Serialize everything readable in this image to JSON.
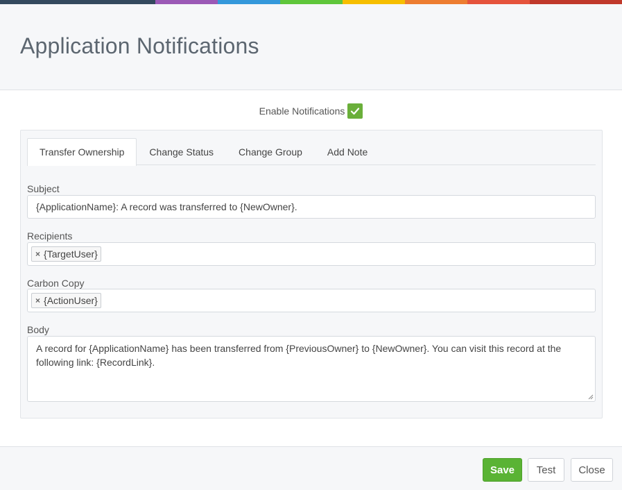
{
  "colors": {
    "top_bar": [
      "#34495e",
      "#9b59b6",
      "#3498db",
      "#5fc63b",
      "#f6be00",
      "#ed7d31",
      "#e5533c",
      "#c0392b"
    ],
    "checkbox": "#6aaf3a",
    "save_button": "#5ab334"
  },
  "header": {
    "title": "Application Notifications"
  },
  "enable": {
    "label": "Enable Notifications",
    "checked": true,
    "icon": "check-icon"
  },
  "tabs": [
    {
      "label": "Transfer Ownership",
      "active": true
    },
    {
      "label": "Change Status",
      "active": false
    },
    {
      "label": "Change Group",
      "active": false
    },
    {
      "label": "Add Note",
      "active": false
    }
  ],
  "form": {
    "subject_label": "Subject",
    "subject_value": "{ApplicationName}: A record was transferred to {NewOwner}.",
    "recipients_label": "Recipients",
    "recipients": [
      "{TargetUser}"
    ],
    "cc_label": "Carbon Copy",
    "cc": [
      "{ActionUser}"
    ],
    "body_label": "Body",
    "body_value": "A record for {ApplicationName} has been transferred from {PreviousOwner} to {NewOwner}. You can visit this record at the following link: {RecordLink}."
  },
  "footer": {
    "save_label": "Save",
    "test_label": "Test",
    "close_label": "Close"
  },
  "tag_remove_glyph": "×"
}
